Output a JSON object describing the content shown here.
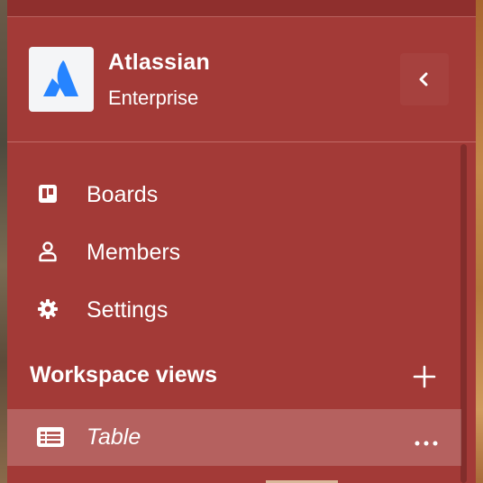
{
  "workspace": {
    "name": "Atlassian",
    "plan": "Enterprise"
  },
  "nav": {
    "items": [
      {
        "label": "Boards",
        "icon": "board-icon"
      },
      {
        "label": "Members",
        "icon": "person-icon"
      },
      {
        "label": "Settings",
        "icon": "gear-icon"
      }
    ]
  },
  "views_section": {
    "title": "Workspace views",
    "items": [
      {
        "label": "Table",
        "icon": "table-icon"
      }
    ]
  },
  "colors": {
    "sidebar_background": "#a33a37",
    "logo_blue": "#2684ff",
    "text": "#ffffff"
  }
}
